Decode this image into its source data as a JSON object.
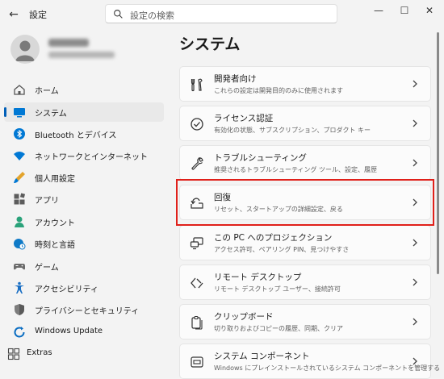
{
  "window": {
    "title": "設定"
  },
  "search": {
    "placeholder": "設定の検索"
  },
  "sidebar": {
    "items": [
      {
        "label": "ホーム",
        "icon": "home-icon"
      },
      {
        "label": "システム",
        "icon": "system-icon",
        "active": true
      },
      {
        "label": "Bluetooth とデバイス",
        "icon": "bluetooth-icon"
      },
      {
        "label": "ネットワークとインターネット",
        "icon": "wifi-icon"
      },
      {
        "label": "個人用設定",
        "icon": "brush-icon"
      },
      {
        "label": "アプリ",
        "icon": "apps-icon"
      },
      {
        "label": "アカウント",
        "icon": "account-icon"
      },
      {
        "label": "時刻と言語",
        "icon": "globe-clock-icon"
      },
      {
        "label": "ゲーム",
        "icon": "gamepad-icon"
      },
      {
        "label": "アクセシビリティ",
        "icon": "accessibility-icon"
      },
      {
        "label": "プライバシーとセキュリティ",
        "icon": "shield-icon"
      },
      {
        "label": "Windows Update",
        "icon": "update-icon"
      },
      {
        "label": "Extras",
        "icon": "extras-icon"
      }
    ]
  },
  "main": {
    "title": "システム",
    "cards": [
      {
        "title": "開発者向け",
        "subtitle": "これらの設定は開発目的のみに使用されます",
        "icon": "developer-tools-icon"
      },
      {
        "title": "ライセンス認証",
        "subtitle": "有効化の状態、サブスクリプション、プロダクト キー",
        "icon": "check-circle-icon"
      },
      {
        "title": "トラブルシューティング",
        "subtitle": "推奨されるトラブルシューティング ツール、設定、履歴",
        "icon": "wrench-icon"
      },
      {
        "title": "回復",
        "subtitle": "リセット、スタートアップの詳細設定、戻る",
        "icon": "recovery-icon"
      },
      {
        "title": "この PC へのプロジェクション",
        "subtitle": "アクセス許可、ペアリング PIN、見つけやすさ",
        "icon": "projection-icon"
      },
      {
        "title": "リモート デスクトップ",
        "subtitle": "リモート デスクトップ ユーザー、接続許可",
        "icon": "remote-desktop-icon"
      },
      {
        "title": "クリップボード",
        "subtitle": "切り取りおよびコピーの履歴、同期、クリア",
        "icon": "clipboard-icon"
      },
      {
        "title": "システム コンポーネント",
        "subtitle": "Windows にプレインストールされているシステム コンポーネントを管理する",
        "icon": "components-icon"
      }
    ]
  },
  "colors": {
    "accent": "#005fb8",
    "highlight": "#e0201a"
  }
}
